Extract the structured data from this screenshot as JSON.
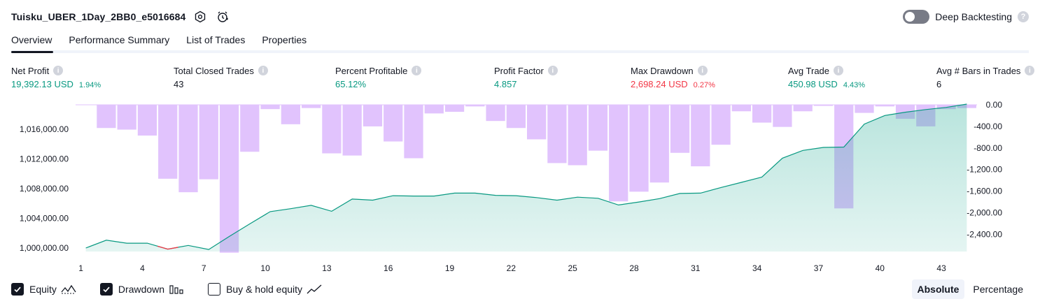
{
  "header": {
    "strategy_name": "Tuisku_UBER_1Day_2BB0_e5016684",
    "settings_icon": "settings-icon",
    "alert_icon": "alert-clock-icon",
    "deep_backtesting_label": "Deep Backtesting",
    "deep_backtesting_enabled": false,
    "help_glyph": "?"
  },
  "tabs": [
    {
      "label": "Overview",
      "active": true
    },
    {
      "label": "Performance Summary",
      "active": false
    },
    {
      "label": "List of Trades",
      "active": false
    },
    {
      "label": "Properties",
      "active": false
    }
  ],
  "metrics": [
    {
      "label": "Net Profit",
      "value": "19,392.13 USD",
      "pct": "1.94%",
      "tone": "green"
    },
    {
      "label": "Total Closed Trades",
      "value": "43",
      "pct": "",
      "tone": "dark"
    },
    {
      "label": "Percent Profitable",
      "value": "65.12%",
      "pct": "",
      "tone": "green"
    },
    {
      "label": "Profit Factor",
      "value": "4.857",
      "pct": "",
      "tone": "green"
    },
    {
      "label": "Max Drawdown",
      "value": "2,698.24 USD",
      "pct": "0.27%",
      "tone": "red"
    },
    {
      "label": "Avg Trade",
      "value": "450.98 USD",
      "pct": "4.43%",
      "tone": "green"
    },
    {
      "label": "Avg # Bars in Trades",
      "value": "6",
      "pct": "",
      "tone": "dark"
    }
  ],
  "info_glyph": "i",
  "chart_data": {
    "type": "line",
    "x": [
      1,
      2,
      3,
      4,
      5,
      6,
      7,
      8,
      9,
      10,
      11,
      12,
      13,
      14,
      15,
      16,
      17,
      18,
      19,
      20,
      21,
      22,
      23,
      24,
      25,
      26,
      27,
      28,
      29,
      30,
      31,
      32,
      33,
      34,
      35,
      36,
      37,
      38,
      39,
      40,
      41,
      42,
      43,
      44
    ],
    "x_tick_labels": [
      "1",
      "4",
      "7",
      "10",
      "13",
      "16",
      "19",
      "22",
      "25",
      "28",
      "31",
      "34",
      "37",
      "40",
      "43"
    ],
    "left_axis": {
      "ticks": [
        "1,000,000.00",
        "1,004,000.00",
        "1,008,000.00",
        "1,012,000.00",
        "1,016,000.00"
      ],
      "range": [
        999600,
        1019000
      ]
    },
    "right_axis": {
      "ticks": [
        "0.00",
        "-400.00",
        "-800.00",
        "-1,200.00",
        "-1,600.00",
        "-2,000.00",
        "-2,400.00"
      ],
      "range": [
        -2700,
        0
      ]
    },
    "series": [
      {
        "name": "Equity",
        "color": "#089981",
        "axis": "left",
        "values": [
          1000000,
          1001050,
          1000650,
          1000650,
          999850,
          1000350,
          999800,
          1001550,
          1003250,
          1004900,
          1005300,
          1005750,
          1004950,
          1006600,
          1006450,
          1007050,
          1007000,
          1007000,
          1007400,
          1007400,
          1007100,
          1007050,
          1006800,
          1006450,
          1006850,
          1006700,
          1005800,
          1006200,
          1006650,
          1007350,
          1007400,
          1008150,
          1008850,
          1009550,
          1012100,
          1013150,
          1013550,
          1013600,
          1016700,
          1017850,
          1018300,
          1018650,
          1018950,
          1019390
        ]
      },
      {
        "name": "Drawdown",
        "color": "#e1c3fd",
        "axis": "right",
        "values": [
          0,
          -430,
          -460,
          -570,
          -1370,
          -1620,
          -1380,
          -2740,
          -870,
          -80,
          -360,
          -60,
          -900,
          -940,
          -400,
          -680,
          -990,
          -160,
          -130,
          -30,
          -300,
          -430,
          -640,
          -1080,
          -1120,
          -850,
          -1790,
          -1610,
          -1440,
          -890,
          -1140,
          -740,
          -120,
          -330,
          -410,
          -120,
          -20,
          -1920,
          -150,
          -30,
          -260,
          -400,
          -80,
          -60
        ]
      }
    ],
    "marker": {
      "x": 5,
      "color": "#f23645"
    }
  },
  "legend": [
    {
      "label": "Equity",
      "checked": true,
      "icon": "equity-line-icon"
    },
    {
      "label": "Drawdown",
      "checked": true,
      "icon": "drawdown-bars-icon"
    },
    {
      "label": "Buy & hold equity",
      "checked": false,
      "icon": "buy-hold-line-icon"
    }
  ],
  "view_modes": [
    {
      "label": "Absolute",
      "active": true
    },
    {
      "label": "Percentage",
      "active": false
    }
  ]
}
